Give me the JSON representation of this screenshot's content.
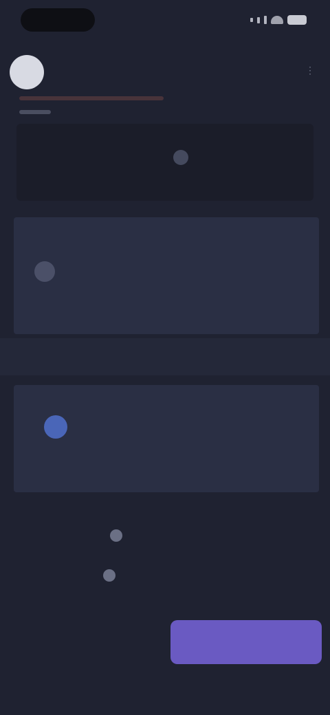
{
  "header": {
    "title": "",
    "menu": "⋮"
  },
  "upload": {
    "hint": ""
  },
  "card1": {
    "title": "",
    "sub": ""
  },
  "section": {
    "label": ""
  },
  "card2": {
    "small": "",
    "sub": ""
  },
  "options": [
    {
      "label": ""
    },
    {
      "label": ""
    }
  ],
  "footer": {
    "secondary": "",
    "primary": ""
  }
}
